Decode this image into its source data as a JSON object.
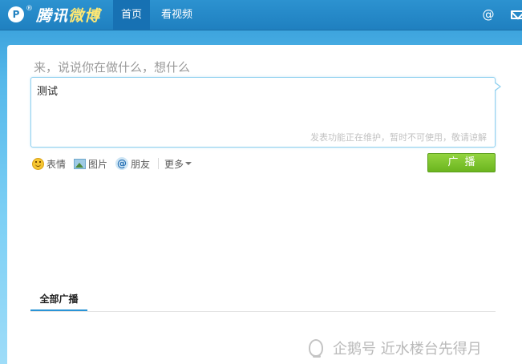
{
  "topbar": {
    "logo_text_a": "腾讯",
    "logo_text_b": "微博",
    "tabs": [
      {
        "label": "首页",
        "active": true
      },
      {
        "label": "看视频",
        "active": false
      }
    ],
    "icons": [
      "at-icon",
      "mail-icon"
    ]
  },
  "composer": {
    "prompt": "来，说说你在做什么，想什么",
    "text": "测试",
    "notice": "发表功能正在维护，暂时不可使用，敬请谅解",
    "tools": [
      {
        "icon": "smile-icon",
        "label": "表情"
      },
      {
        "icon": "picture-icon",
        "label": "图片"
      },
      {
        "icon": "friend-icon",
        "label": "朋友"
      }
    ],
    "more_label": "更多",
    "submit_label": "广播"
  },
  "feed": {
    "tab_label": "全部广播"
  },
  "watermark": "企鹅号 近水楼台先得月",
  "colors": {
    "brand_blue": "#1f80c0",
    "submit_green": "#6bb51f",
    "tab_underline": "#2a94d6"
  }
}
